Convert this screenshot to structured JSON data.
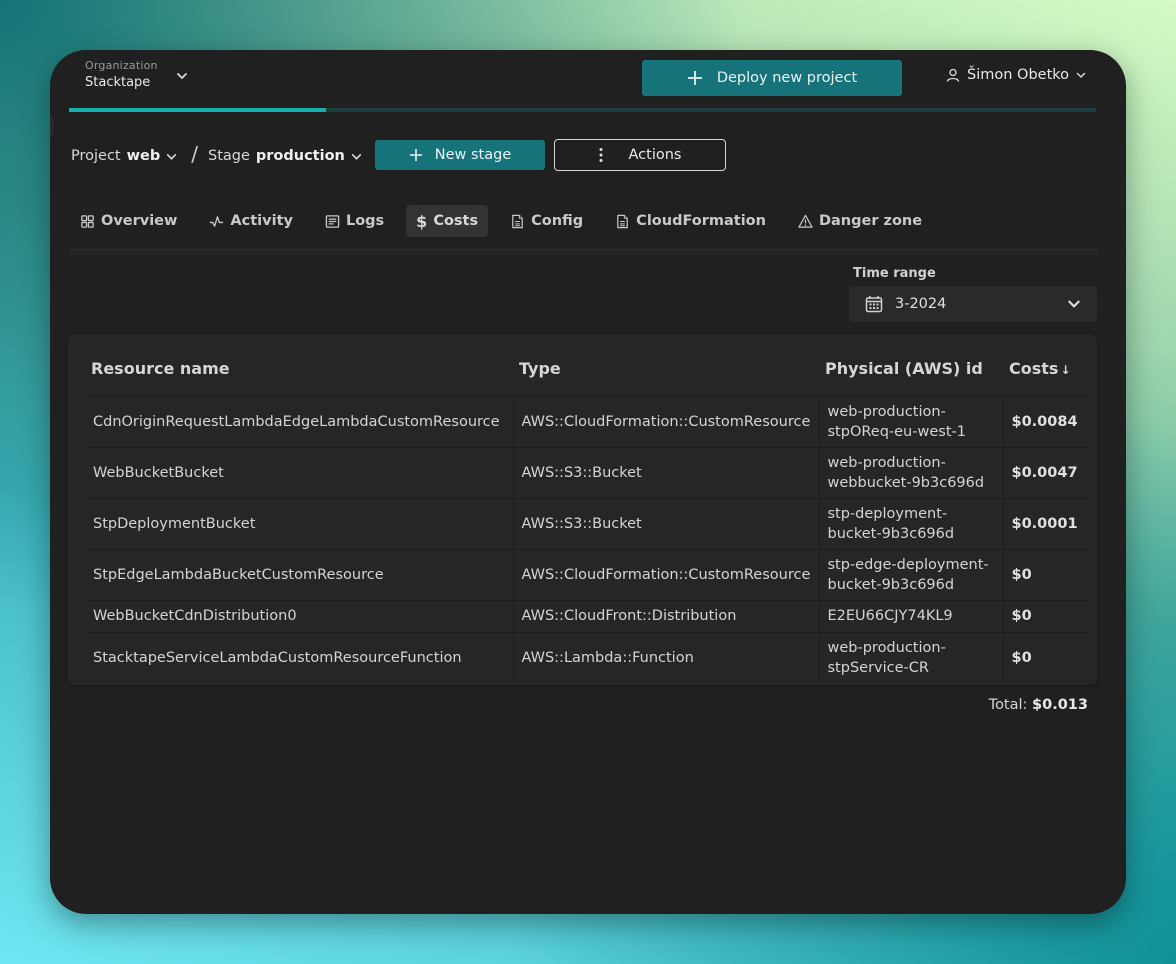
{
  "header": {
    "organization_label": "Organization",
    "organization_value": "Stacktape",
    "deploy_button": "Deploy new project",
    "user_name": "Šimon Obetko",
    "progress_fraction": 0.25
  },
  "project_bar": {
    "project_prefix": "Project",
    "project_value": "web",
    "separator": "/",
    "stage_prefix": "Stage",
    "stage_value": "production",
    "new_stage_button": "New stage",
    "actions_button": "Actions"
  },
  "tabs": [
    {
      "label": "Overview",
      "icon": "grid-icon",
      "active": false
    },
    {
      "label": "Activity",
      "icon": "activity-icon",
      "active": false
    },
    {
      "label": "Logs",
      "icon": "logs-icon",
      "active": false
    },
    {
      "label": "Costs",
      "icon": "dollar-icon",
      "active": true
    },
    {
      "label": "Config",
      "icon": "document-icon",
      "active": false
    },
    {
      "label": "CloudFormation",
      "icon": "document-icon",
      "active": false
    },
    {
      "label": "Danger zone",
      "icon": "warning-icon",
      "active": false
    }
  ],
  "time_range": {
    "label": "Time range",
    "value": "3-2024"
  },
  "table": {
    "columns": [
      "Resource name",
      "Type",
      "Physical (AWS) id",
      "Costs"
    ],
    "sort_indicator": "↓",
    "rows": [
      {
        "name": "CdnOriginRequestLambdaEdgeLambdaCustomResource",
        "type": "AWS::CloudFormation::CustomResource",
        "physical_id_1": "web-production-",
        "physical_id_2": "stpOReq-eu-west-1",
        "cost": "$0.0084"
      },
      {
        "name": "WebBucketBucket",
        "type": "AWS::S3::Bucket",
        "physical_id_1": "web-production-",
        "physical_id_2": "webbucket-9b3c696d",
        "cost": "$0.0047"
      },
      {
        "name": "StpDeploymentBucket",
        "type": "AWS::S3::Bucket",
        "physical_id_1": "stp-deployment-",
        "physical_id_2": "bucket-9b3c696d",
        "cost": "$0.0001"
      },
      {
        "name": "StpEdgeLambdaBucketCustomResource",
        "type": "AWS::CloudFormation::CustomResource",
        "physical_id_1": "stp-edge-deployment-",
        "physical_id_2": "bucket-9b3c696d",
        "cost": "$0"
      },
      {
        "name": "WebBucketCdnDistribution0",
        "type": "AWS::CloudFront::Distribution",
        "physical_id_1": "E2EU66CJY74KL9",
        "physical_id_2": "",
        "cost": "$0"
      },
      {
        "name": "StacktapeServiceLambdaCustomResourceFunction",
        "type": "AWS::Lambda::Function",
        "physical_id_1": "web-production-",
        "physical_id_2": "stpService-CR",
        "cost": "$0"
      }
    ]
  },
  "total": {
    "label": "Total:",
    "value": "$0.013"
  },
  "colors": {
    "accent": "#16737a",
    "progress": "#18b0ad",
    "window_bg": "#202020"
  }
}
